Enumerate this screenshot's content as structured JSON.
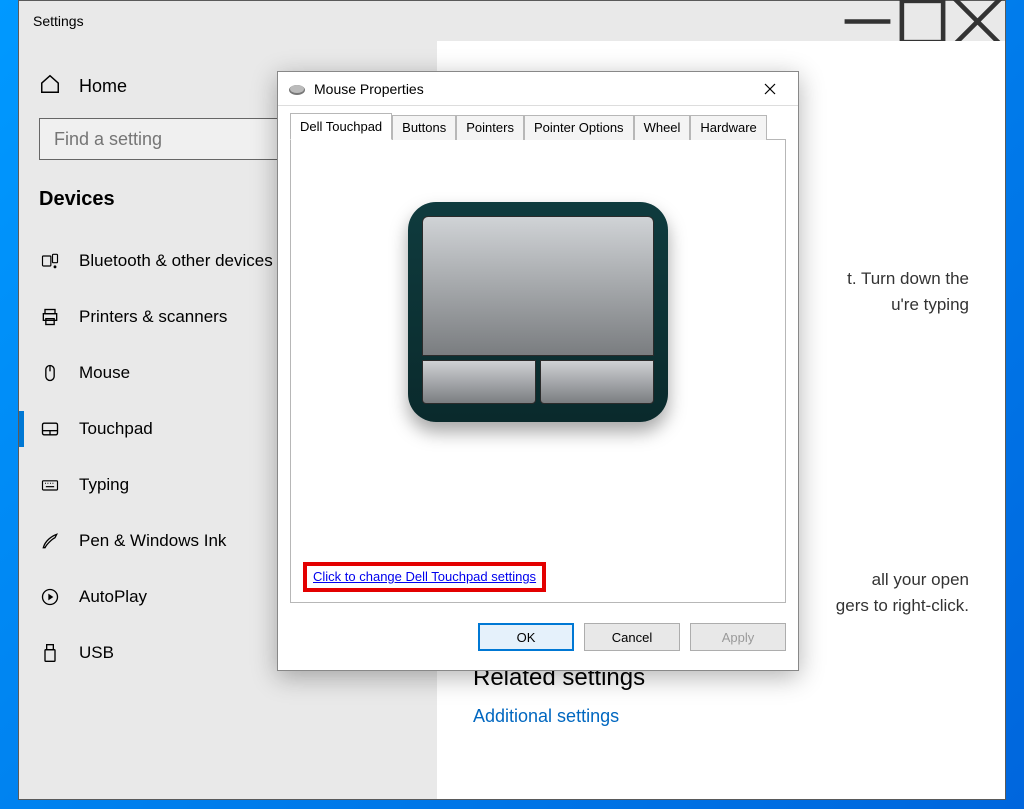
{
  "settings": {
    "title": "Settings",
    "home": "Home",
    "search_placeholder": "Find a setting",
    "category": "Devices",
    "nav": [
      "Bluetooth & other devices",
      "Printers & scanners",
      "Mouse",
      "Touchpad",
      "Typing",
      "Pen & Windows Ink",
      "AutoPlay",
      "USB"
    ]
  },
  "main": {
    "block1_a": "t. Turn down the",
    "block1_b": "u're typing",
    "block2_a": "all your open",
    "block2_b": "gers to right-click.",
    "related_title": "Related settings",
    "related_link": "Additional settings"
  },
  "dialog": {
    "title": "Mouse Properties",
    "tabs": [
      "Dell Touchpad",
      "Buttons",
      "Pointers",
      "Pointer Options",
      "Wheel",
      "Hardware"
    ],
    "change_link": "Click to change Dell Touchpad settings",
    "ok": "OK",
    "cancel": "Cancel",
    "apply": "Apply"
  }
}
